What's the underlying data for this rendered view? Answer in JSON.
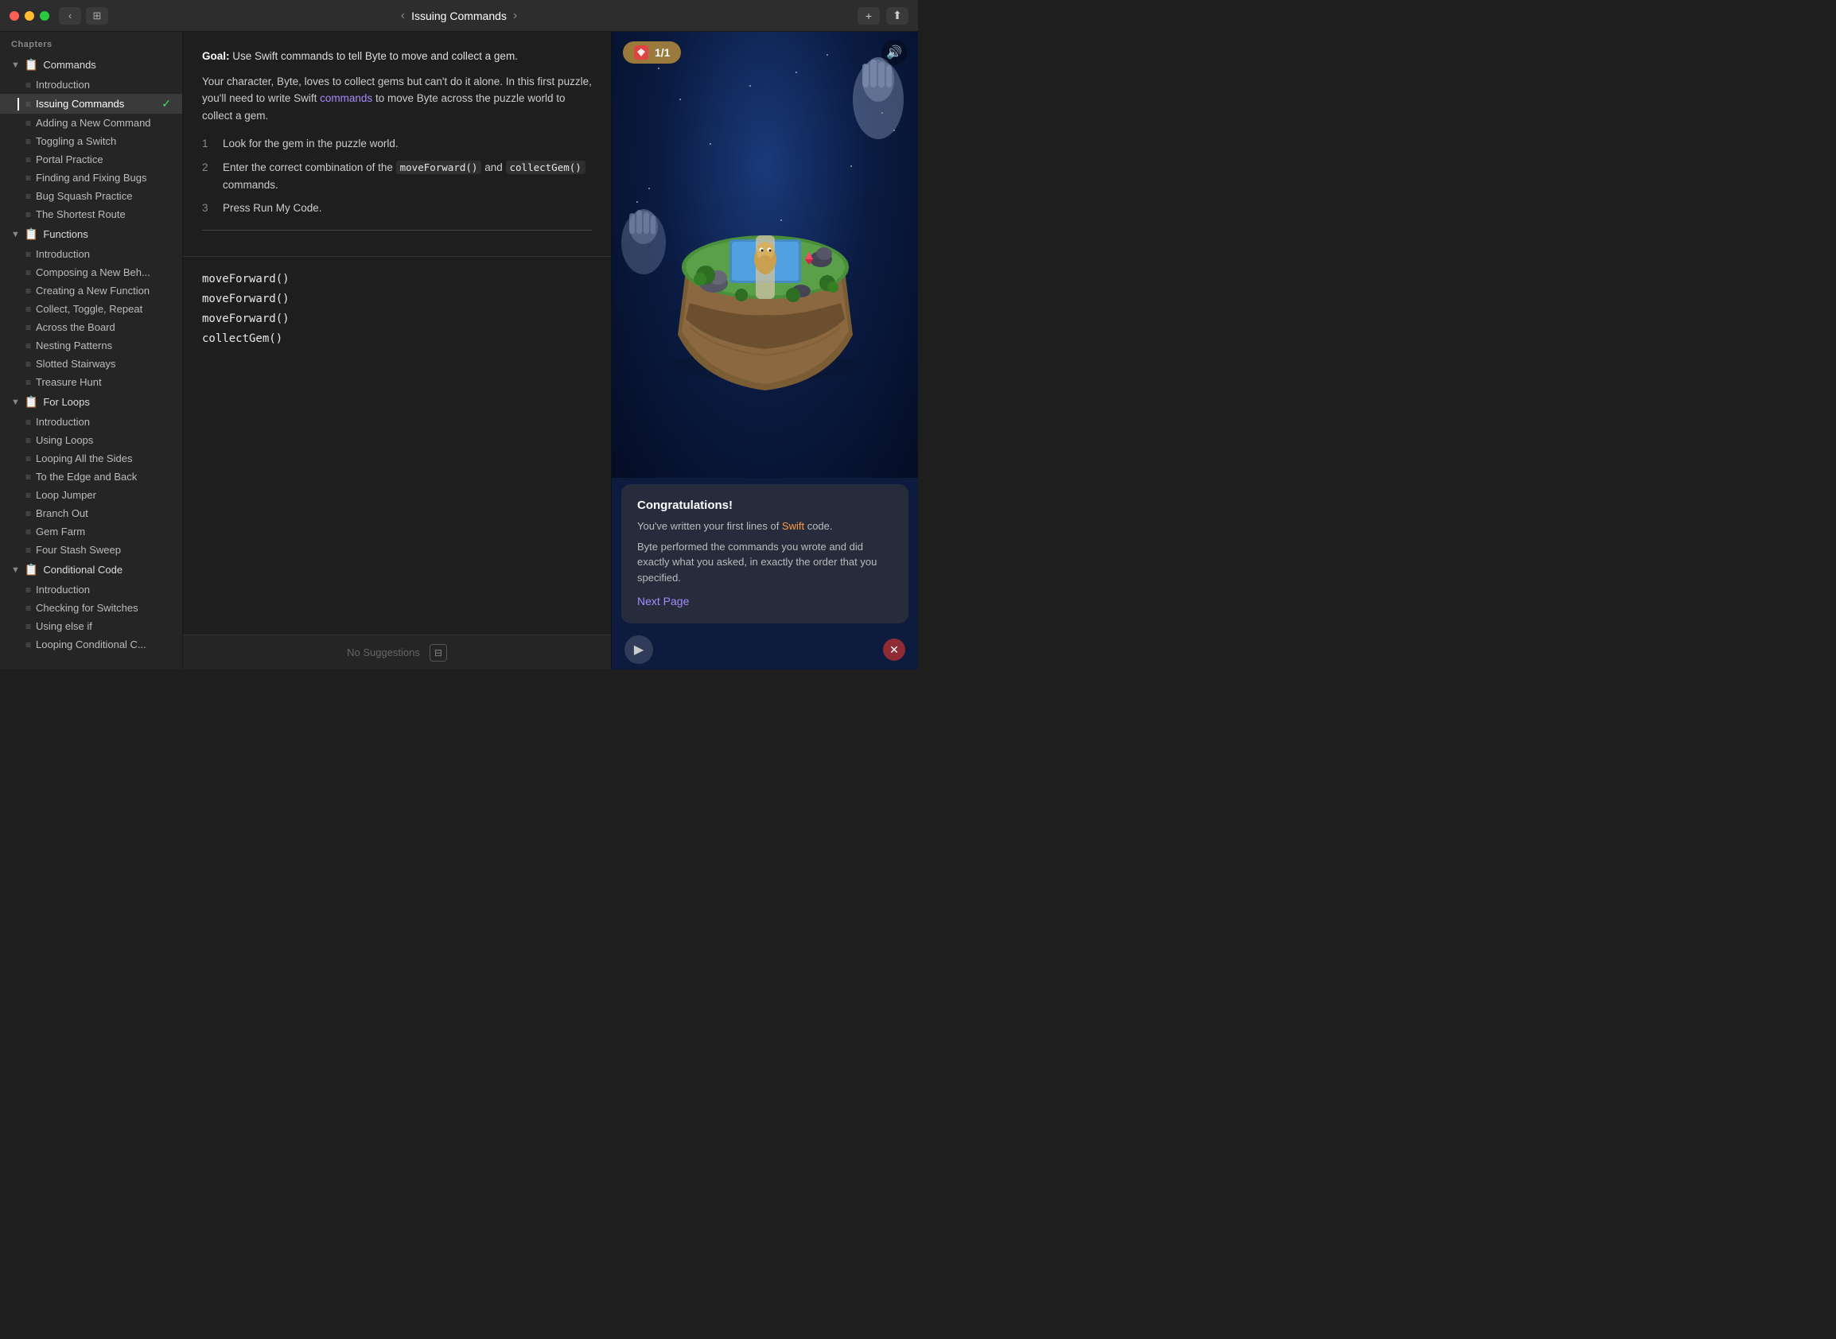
{
  "titlebar": {
    "title": "Issuing Commands",
    "back_label": "‹",
    "forward_label": "›",
    "add_label": "+",
    "share_label": "⬆"
  },
  "sidebar": {
    "chapters_label": "Chapters",
    "groups": [
      {
        "name": "Commands",
        "icon": "📄",
        "items": [
          {
            "label": "Introduction",
            "active": false,
            "checked": false
          },
          {
            "label": "Issuing Commands",
            "active": true,
            "checked": true
          },
          {
            "label": "Adding a New Command",
            "active": false,
            "checked": false
          },
          {
            "label": "Toggling a Switch",
            "active": false,
            "checked": false
          },
          {
            "label": "Portal Practice",
            "active": false,
            "checked": false
          },
          {
            "label": "Finding and Fixing Bugs",
            "active": false,
            "checked": false
          },
          {
            "label": "Bug Squash Practice",
            "active": false,
            "checked": false
          },
          {
            "label": "The Shortest Route",
            "active": false,
            "checked": false
          }
        ]
      },
      {
        "name": "Functions",
        "icon": "📄",
        "items": [
          {
            "label": "Introduction",
            "active": false,
            "checked": false
          },
          {
            "label": "Composing a New Beh...",
            "active": false,
            "checked": false
          },
          {
            "label": "Creating a New Function",
            "active": false,
            "checked": false
          },
          {
            "label": "Collect, Toggle, Repeat",
            "active": false,
            "checked": false
          },
          {
            "label": "Across the Board",
            "active": false,
            "checked": false
          },
          {
            "label": "Nesting Patterns",
            "active": false,
            "checked": false
          },
          {
            "label": "Slotted Stairways",
            "active": false,
            "checked": false
          },
          {
            "label": "Treasure Hunt",
            "active": false,
            "checked": false
          }
        ]
      },
      {
        "name": "For Loops",
        "icon": "📄",
        "items": [
          {
            "label": "Introduction",
            "active": false,
            "checked": false
          },
          {
            "label": "Using Loops",
            "active": false,
            "checked": false
          },
          {
            "label": "Looping All the Sides",
            "active": false,
            "checked": false
          },
          {
            "label": "To the Edge and Back",
            "active": false,
            "checked": false
          },
          {
            "label": "Loop Jumper",
            "active": false,
            "checked": false
          },
          {
            "label": "Branch Out",
            "active": false,
            "checked": false
          },
          {
            "label": "Gem Farm",
            "active": false,
            "checked": false
          },
          {
            "label": "Four Stash Sweep",
            "active": false,
            "checked": false
          }
        ]
      },
      {
        "name": "Conditional Code",
        "icon": "📄",
        "items": [
          {
            "label": "Introduction",
            "active": false,
            "checked": false
          },
          {
            "label": "Checking for Switches",
            "active": false,
            "checked": false
          },
          {
            "label": "Using else if",
            "active": false,
            "checked": false
          },
          {
            "label": "Looping Conditional C...",
            "active": false,
            "checked": false
          }
        ]
      }
    ]
  },
  "instructions": {
    "goal_label": "Goal:",
    "goal_text": " Use Swift commands to tell Byte to move and collect a gem.",
    "description": "Your character, Byte, loves to collect gems but can't do it alone. In this first puzzle, you'll need to write Swift ",
    "commands_link": "commands",
    "description2": " to move Byte across the puzzle world to collect a gem.",
    "steps": [
      {
        "num": "1",
        "text": "Look for the gem in the puzzle world."
      },
      {
        "num": "2",
        "text": "Enter the correct combination of the moveForward() and collectGem() commands."
      },
      {
        "num": "3",
        "text": "Press Run My Code."
      }
    ]
  },
  "code": {
    "lines": [
      "moveForward()",
      "moveForward()",
      "moveForward()",
      "collectGem()"
    ]
  },
  "suggestions": {
    "text": "No Suggestions",
    "icon_label": "⬜"
  },
  "game": {
    "gem_counter": "1/1",
    "gem_icon": "🔴",
    "congratulations": {
      "title": "Congratulations!",
      "body1_pre": "You've written your first lines of ",
      "swift_label": "Swift",
      "body1_post": " code.",
      "body2": "Byte performed the commands you wrote and did exactly what you asked, in exactly the order that you specified.",
      "next_page": "Next Page"
    }
  }
}
